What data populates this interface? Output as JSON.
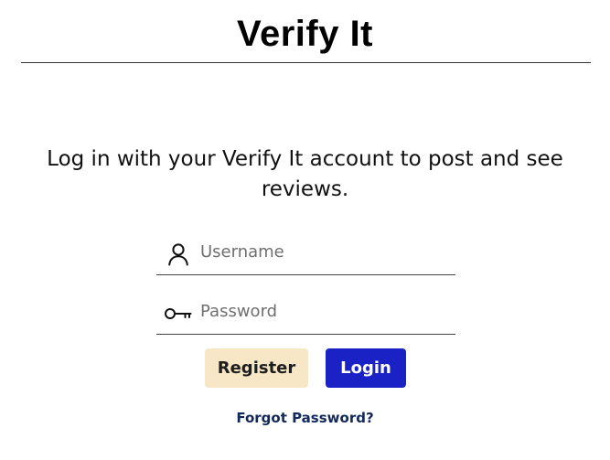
{
  "header": {
    "title": "Verify It"
  },
  "intro": {
    "text": "Log in with your Verify It account to post and see reviews."
  },
  "form": {
    "username": {
      "placeholder": "Username",
      "value": "",
      "icon": "user-icon"
    },
    "password": {
      "placeholder": "Password",
      "value": "",
      "icon": "key-icon"
    }
  },
  "actions": {
    "register_label": "Register",
    "login_label": "Login",
    "forgot_label": "Forgot Password?"
  },
  "colors": {
    "register_bg": "#f8e7c6",
    "login_bg": "#1a21c5",
    "link": "#13295a",
    "divider": "#333333"
  }
}
